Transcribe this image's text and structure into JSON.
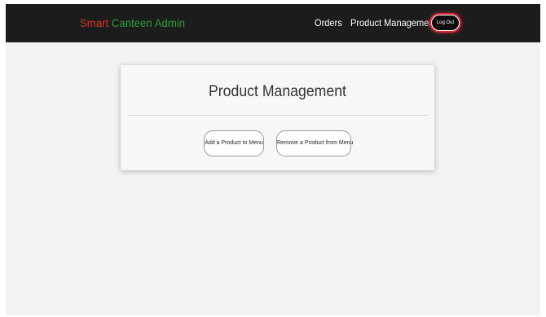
{
  "navbar": {
    "brand_first": "Smart",
    "brand_rest": " Canteen Admin",
    "links": {
      "orders": "Orders",
      "product_management": "Product Management"
    },
    "logout_label": "Log Out"
  },
  "card": {
    "title": "Product Management",
    "add_button": "Add a Product to Menu",
    "remove_button": "Remove a Product from Menu"
  },
  "colors": {
    "navbar_bg": "#1c1c1c",
    "brand_smart": "#e0302a",
    "brand_rest": "#2e9e3a",
    "logout_glow": "#d22838",
    "page_bg": "#f2f2f2"
  }
}
